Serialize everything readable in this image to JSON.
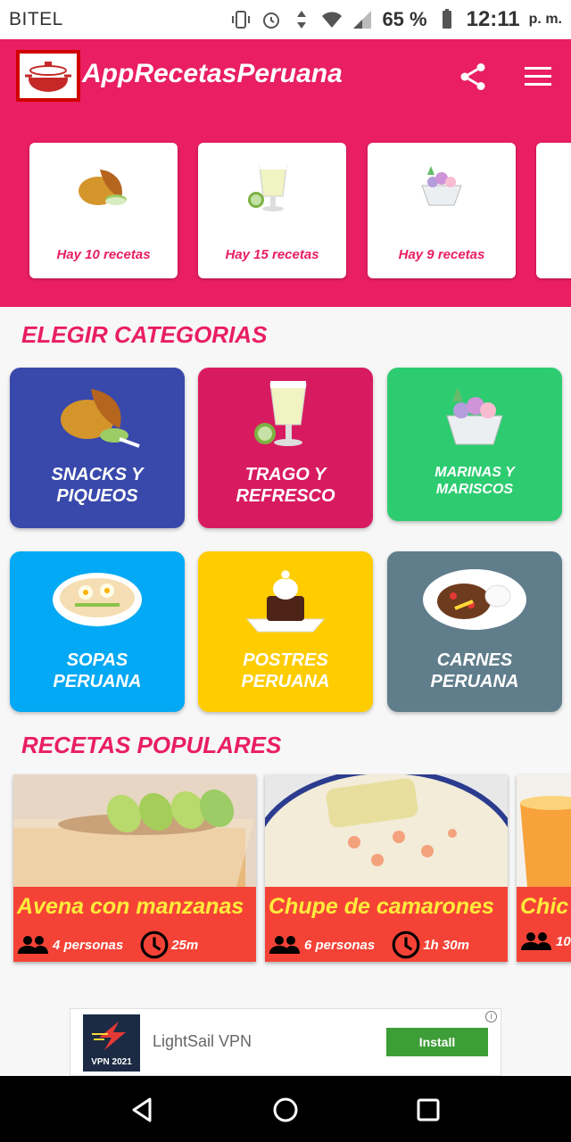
{
  "status_bar": {
    "carrier": "BITEL",
    "battery": "65 %",
    "time": "12:11",
    "ampm": "p. m."
  },
  "app_bar": {
    "title": "AppRecetasPeruana",
    "color": "#e91e63"
  },
  "summary_cards": [
    {
      "count": "Hay 10 recetas",
      "icon": "empanada-icon"
    },
    {
      "count": "Hay 15 recetas",
      "icon": "pisco-sour-icon"
    },
    {
      "count": "Hay 9 recetas",
      "icon": "ceviche-icon"
    }
  ],
  "categories_title": "ELEGIR CATEGORIAS",
  "categories": [
    {
      "label": "SNACKS Y\nPIQUEOS",
      "color": "#3949ab",
      "icon": "empanada-icon"
    },
    {
      "label": "TRAGO Y\nREFRESCO",
      "color": "#d81b60",
      "icon": "pisco-sour-icon"
    },
    {
      "label": "MARINAS Y\nMARISCOS",
      "color": "#2ecc71",
      "icon": "ceviche-icon"
    },
    {
      "label": "SOPAS\nPERUANA",
      "color": "#03a9f4",
      "icon": "soup-bowl-icon"
    },
    {
      "label": "POSTRES\nPERUANA",
      "color": "#ffcc00",
      "icon": "dessert-icon"
    },
    {
      "label": "CARNES\nPERUANA",
      "color": "#607d8b",
      "icon": "meat-plate-icon"
    }
  ],
  "popular_title": "RECETAS POPULARES",
  "popular": [
    {
      "name": "Avena con manzanas",
      "servings": "4 personas",
      "time": "25m"
    },
    {
      "name": "Chupe de camarones",
      "servings": "6 personas",
      "time": "1h 30m"
    },
    {
      "name": "Chic",
      "servings": "10",
      "time": ""
    }
  ],
  "ad": {
    "name": "LightSail VPN",
    "logo_text": "VPN 2021",
    "button": "Install",
    "info": "i"
  },
  "colors": {
    "popular_info_bg": "#f44336",
    "popular_name": "#ffeb3b",
    "ad_button": "#3d9d36"
  }
}
